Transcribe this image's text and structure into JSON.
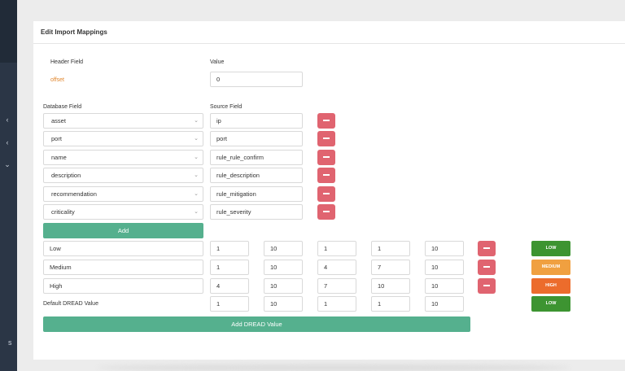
{
  "page": {
    "title": "Edit Import Mappings"
  },
  "sidebar": {
    "icons": [
      "chevron-left-icon",
      "chevron-left-icon",
      "chevron-down-icon"
    ],
    "fragment": "s"
  },
  "header": {
    "field_label": "Header Field",
    "value_label": "Value",
    "field": "offset",
    "value": "0"
  },
  "mapping": {
    "db_label": "Database Field",
    "src_label": "Source Field",
    "rows": [
      {
        "db": "asset",
        "src": "ip"
      },
      {
        "db": "port",
        "src": "port"
      },
      {
        "db": "name",
        "src": "rule_rule_confirm"
      },
      {
        "db": "description",
        "src": "rule_description"
      },
      {
        "db": "recommendation",
        "src": "rule_mitigation"
      },
      {
        "db": "criticality",
        "src": "rule_severity"
      }
    ],
    "add_label": "Add"
  },
  "dread": {
    "rows": [
      {
        "name": "Low",
        "v": [
          "1",
          "10",
          "1",
          "1",
          "10"
        ],
        "badge": "LOW",
        "badge_color": "#3d9431"
      },
      {
        "name": "Medium",
        "v": [
          "1",
          "10",
          "4",
          "7",
          "10"
        ],
        "badge": "MEDIUM",
        "badge_color": "#f0a040"
      },
      {
        "name": "High",
        "v": [
          "4",
          "10",
          "7",
          "10",
          "10"
        ],
        "badge": "HIGH",
        "badge_color": "#ec6c2c"
      }
    ],
    "default": {
      "label": "Default DREAD Value",
      "v": [
        "1",
        "10",
        "1",
        "1",
        "10"
      ],
      "badge": "LOW",
      "badge_color": "#3d9431"
    },
    "add_label": "Add DREAD Value"
  },
  "colors": {
    "accent": "#55b08e",
    "danger": "#e06470",
    "sidebar": "#2b3646"
  }
}
